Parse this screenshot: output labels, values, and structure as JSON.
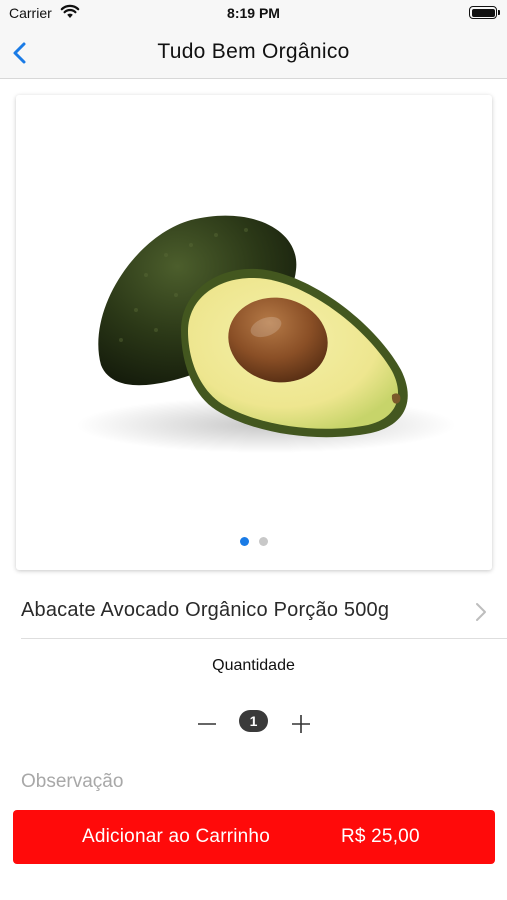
{
  "status_bar": {
    "carrier": "Carrier",
    "time": "8:19 PM"
  },
  "nav": {
    "title": "Tudo Bem Orgânico",
    "back_icon": "chevron-left-icon"
  },
  "gallery": {
    "image": "avocado-halves",
    "page_count": 2,
    "current_page": 1
  },
  "product": {
    "name": "Abacate Avocado Orgânico Porção 500g"
  },
  "quantity": {
    "label": "Quantidade",
    "value": "1"
  },
  "observation": {
    "placeholder": "Observação",
    "value": ""
  },
  "cart_button": {
    "label": "Adicionar ao Carrinho",
    "price": "R$ 25,00"
  },
  "colors": {
    "accent_blue": "#1a7be6",
    "cta_red": "#ff0a0a",
    "dot_inactive": "#c8c8c8"
  }
}
